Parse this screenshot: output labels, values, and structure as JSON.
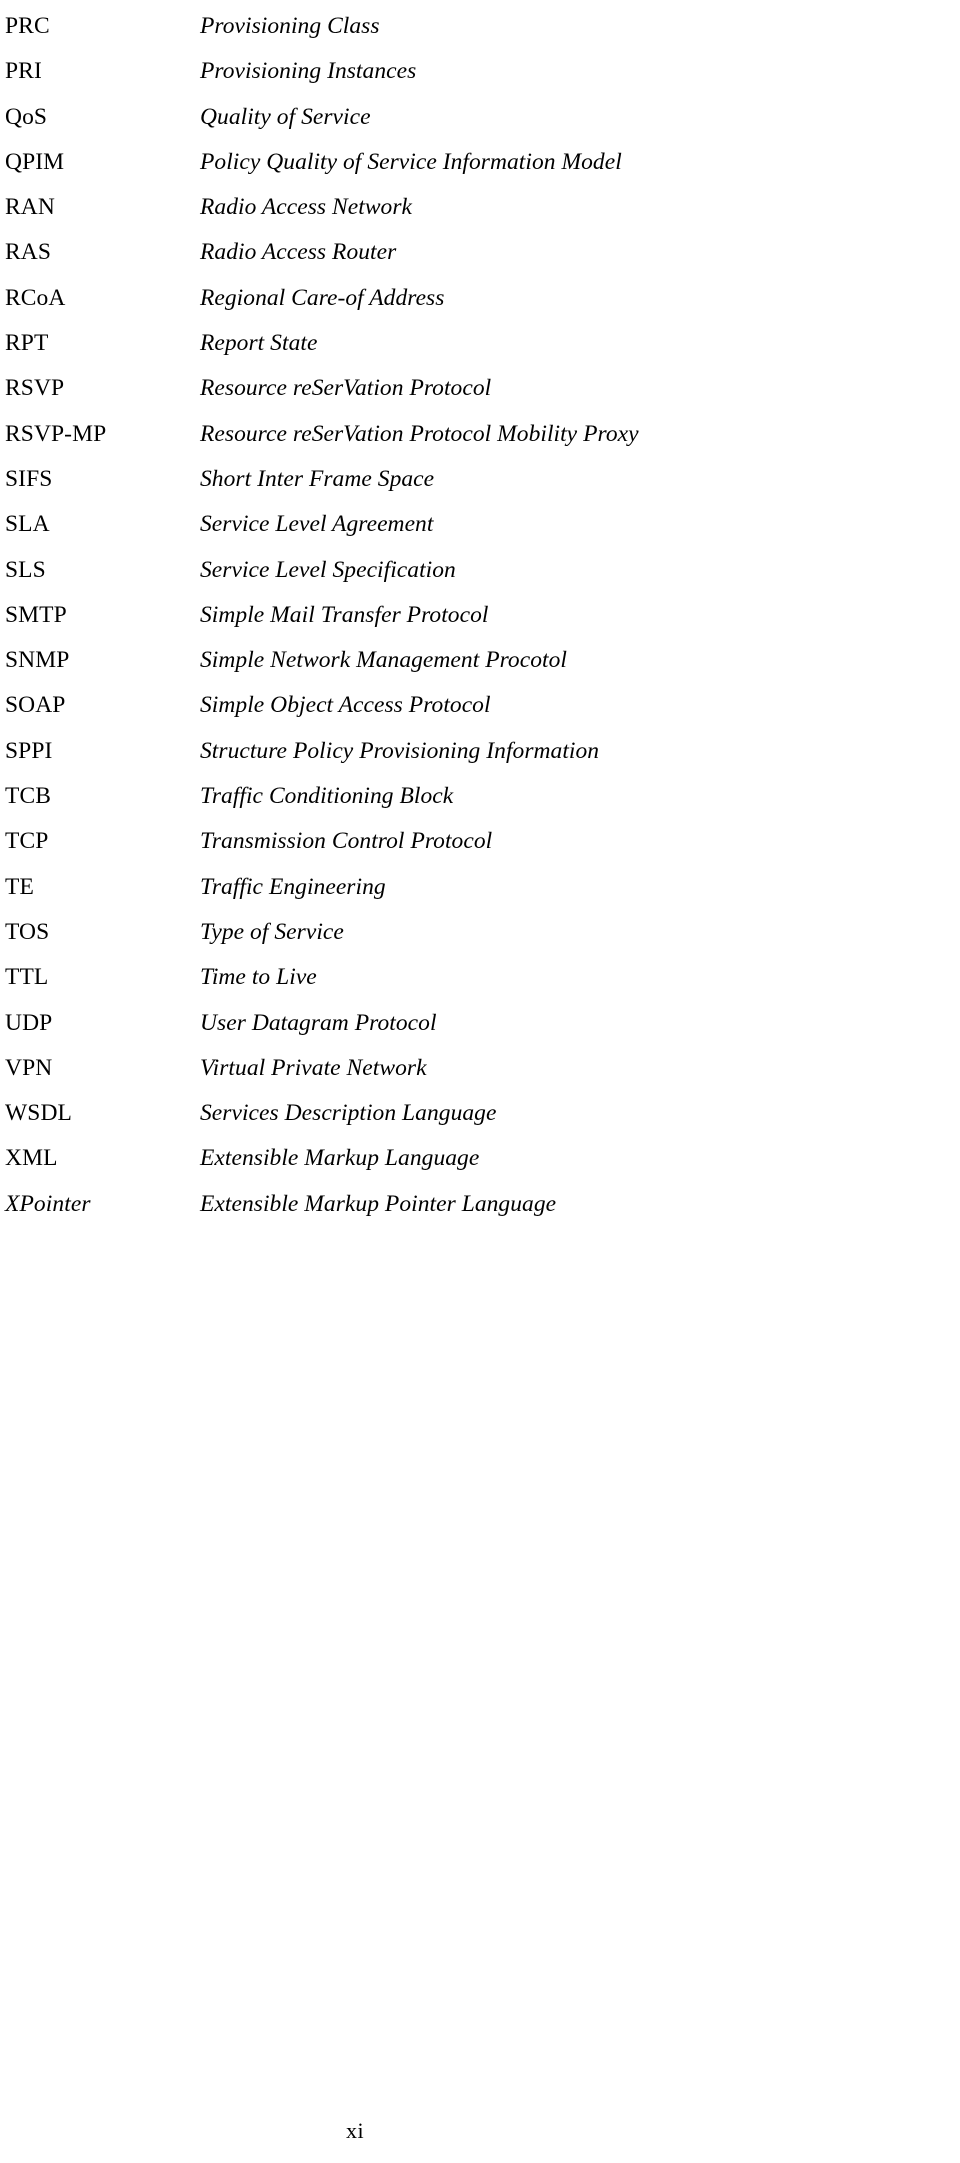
{
  "page": {
    "kind": "abbreviations-glossary",
    "background_color": "#ffffff",
    "text_color": "#000000",
    "folio": "xi"
  },
  "glossary": {
    "rows": [
      {
        "abbr": "PRC",
        "abbr_style": "upright",
        "expansion": "Provisioning Class"
      },
      {
        "abbr": "PRI",
        "abbr_style": "upright",
        "expansion": "Provisioning Instances"
      },
      {
        "abbr": "QoS",
        "abbr_style": "upright",
        "expansion": "Quality of Service"
      },
      {
        "abbr": "QPIM",
        "abbr_style": "upright",
        "expansion": "Policy Quality of Service Information Model"
      },
      {
        "abbr": "RAN",
        "abbr_style": "upright",
        "expansion": "Radio Access Network"
      },
      {
        "abbr": "RAS",
        "abbr_style": "upright",
        "expansion": "Radio Access Router"
      },
      {
        "abbr": "RCoA",
        "abbr_style": "upright",
        "expansion": "Regional Care-of Address"
      },
      {
        "abbr": "RPT",
        "abbr_style": "upright",
        "expansion": "Report State"
      },
      {
        "abbr": "RSVP",
        "abbr_style": "upright",
        "expansion": "Resource reSerVation Protocol"
      },
      {
        "abbr": "RSVP-MP",
        "abbr_style": "upright",
        "expansion": "Resource reSerVation Protocol Mobility Proxy"
      },
      {
        "abbr": "SIFS",
        "abbr_style": "upright",
        "expansion": "Short Inter Frame Space"
      },
      {
        "abbr": "SLA",
        "abbr_style": "upright",
        "expansion": "Service Level Agreement"
      },
      {
        "abbr": "SLS",
        "abbr_style": "upright",
        "expansion": "Service Level Specification"
      },
      {
        "abbr": "SMTP",
        "abbr_style": "upright",
        "expansion": "Simple Mail Transfer Protocol"
      },
      {
        "abbr": "SNMP",
        "abbr_style": "upright",
        "expansion": "Simple Network Management Procotol"
      },
      {
        "abbr": "SOAP",
        "abbr_style": "upright",
        "expansion": "Simple Object Access Protocol"
      },
      {
        "abbr": "SPPI",
        "abbr_style": "upright",
        "expansion": "Structure Policy Provisioning Information"
      },
      {
        "abbr": "TCB",
        "abbr_style": "upright",
        "expansion": "Traffic Conditioning Block"
      },
      {
        "abbr": "TCP",
        "abbr_style": "upright",
        "expansion": "Transmission Control Protocol"
      },
      {
        "abbr": "TE",
        "abbr_style": "upright",
        "expansion": "Traffic Engineering"
      },
      {
        "abbr": "TOS",
        "abbr_style": "upright",
        "expansion": "Type of Service"
      },
      {
        "abbr": "TTL",
        "abbr_style": "upright",
        "expansion": "Time to Live"
      },
      {
        "abbr": "UDP",
        "abbr_style": "upright",
        "expansion": "User Datagram Protocol"
      },
      {
        "abbr": "VPN",
        "abbr_style": "upright",
        "expansion": "Virtual Private Network"
      },
      {
        "abbr": "WSDL",
        "abbr_style": "upright",
        "expansion": "Services Description Language"
      },
      {
        "abbr": "XML",
        "abbr_style": "upright",
        "expansion": "Extensible Markup Language"
      },
      {
        "abbr": "XPointer",
        "abbr_style": "italic",
        "expansion": "Extensible Markup Pointer Language"
      }
    ]
  }
}
